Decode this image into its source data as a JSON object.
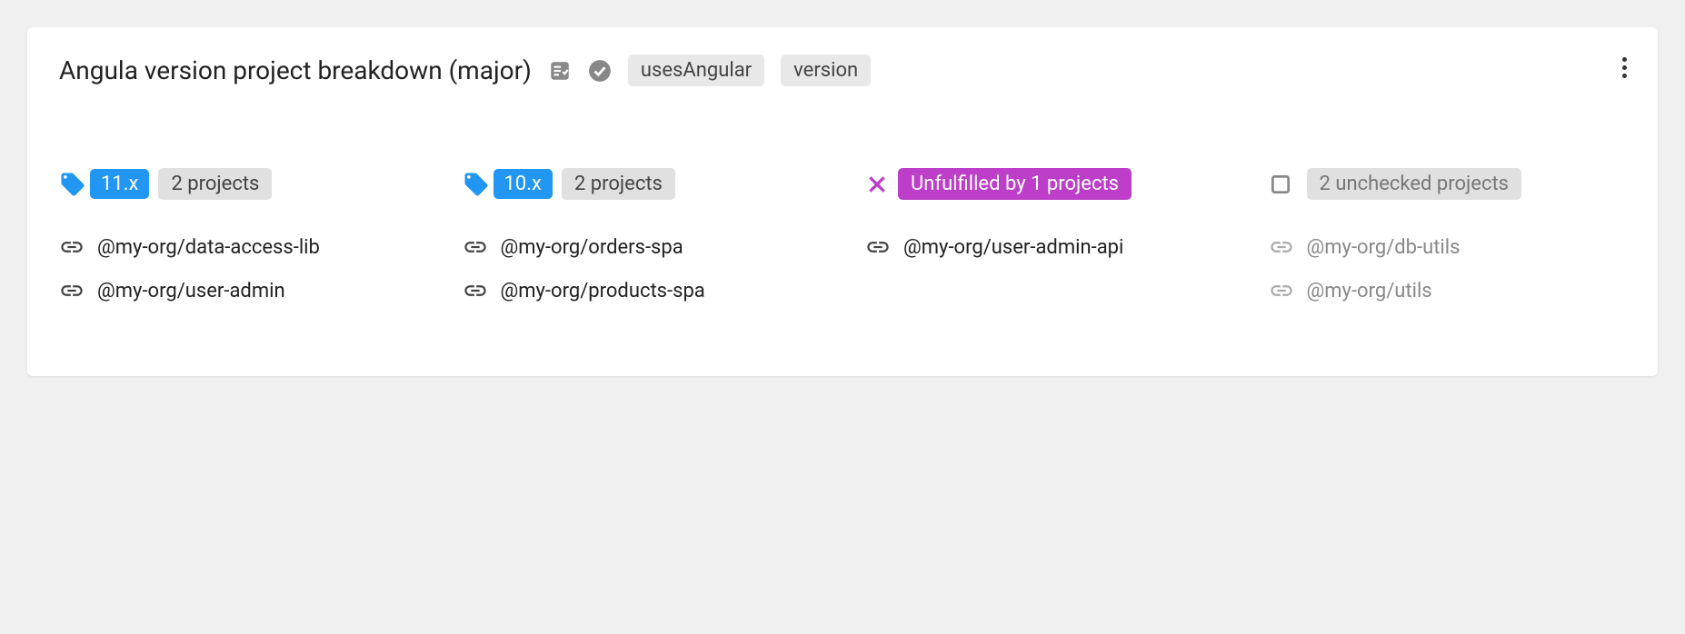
{
  "card": {
    "title": "Angula version project breakdown (major)",
    "tags": [
      "usesAngular",
      "version"
    ]
  },
  "columns": [
    {
      "type": "version",
      "version": "11.x",
      "count_label": "2 projects",
      "projects": [
        "@my-org/data-access-lib",
        "@my-org/user-admin"
      ]
    },
    {
      "type": "version",
      "version": "10.x",
      "count_label": "2 projects",
      "projects": [
        "@my-org/orders-spa",
        "@my-org/products-spa"
      ]
    },
    {
      "type": "unfulfilled",
      "badge_label": "Unfulfilled by 1 projects",
      "projects": [
        "@my-org/user-admin-api"
      ]
    },
    {
      "type": "unchecked",
      "count_label": "2 unchecked projects",
      "projects": [
        "@my-org/db-utils",
        "@my-org/utils"
      ]
    }
  ]
}
